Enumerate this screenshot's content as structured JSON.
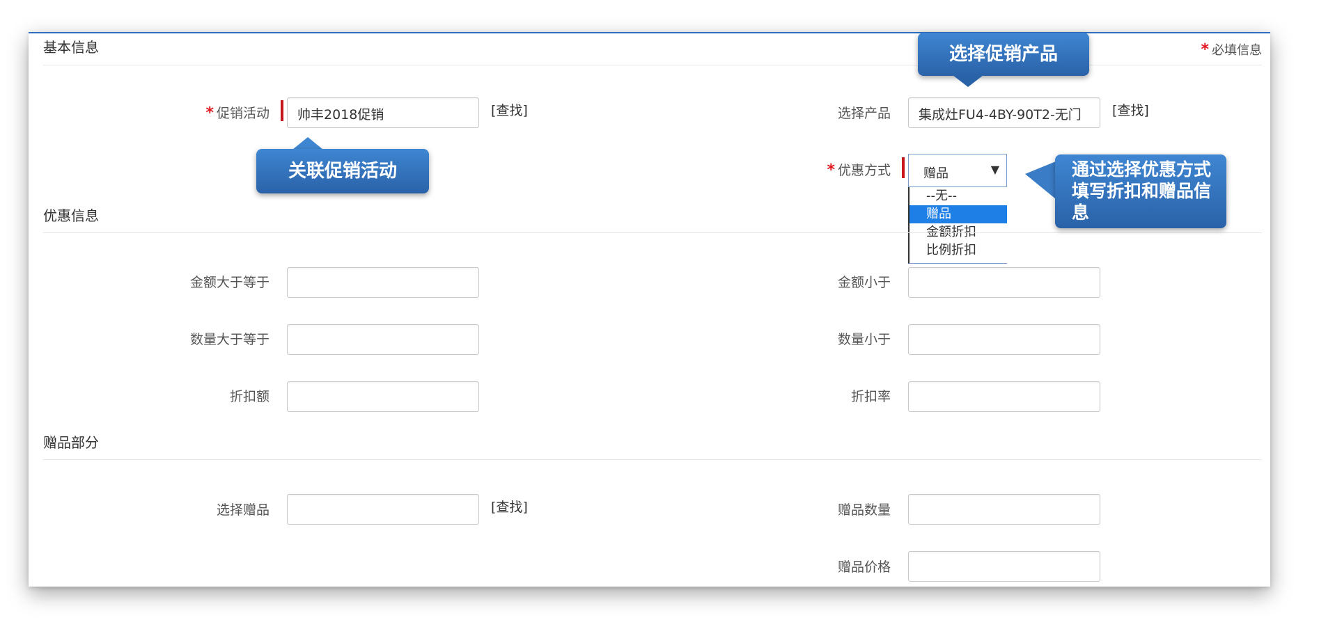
{
  "sections": {
    "basic": "基本信息",
    "discount": "优惠信息",
    "gift": "赠品部分"
  },
  "required_note": "必填信息",
  "required_mark": "*",
  "find_label": "[查找]",
  "fields": {
    "promo_activity": {
      "label": "促销活动",
      "value": "帅丰2018促销"
    },
    "select_product": {
      "label": "选择产品",
      "value": "集成灶FU4-4BY-90T2-无门"
    },
    "discount_method": {
      "label": "优惠方式",
      "value": "赠品",
      "options": [
        "--无--",
        "赠品",
        "金额折扣",
        "比例折扣"
      ],
      "highlighted": "赠品"
    },
    "amount_gte": {
      "label": "金额大于等于",
      "value": ""
    },
    "amount_lt": {
      "label": "金额小于",
      "value": ""
    },
    "qty_gte": {
      "label": "数量大于等于",
      "value": ""
    },
    "qty_lt": {
      "label": "数量小于",
      "value": ""
    },
    "discount_amount": {
      "label": "折扣额",
      "value": ""
    },
    "discount_rate": {
      "label": "折扣率",
      "value": ""
    },
    "select_gift": {
      "label": "选择赠品",
      "value": ""
    },
    "gift_qty": {
      "label": "赠品数量",
      "value": ""
    },
    "gift_price": {
      "label": "赠品价格",
      "value": ""
    }
  },
  "callouts": {
    "product": "选择促销产品",
    "activity": "关联促销活动",
    "method": "通过选择优惠方式填写折扣和赠品信息"
  },
  "colors": {
    "accent": "#2e6fbf",
    "required": "#e0141e",
    "callout": "#2f6db5",
    "highlight": "#1e7fe6"
  }
}
